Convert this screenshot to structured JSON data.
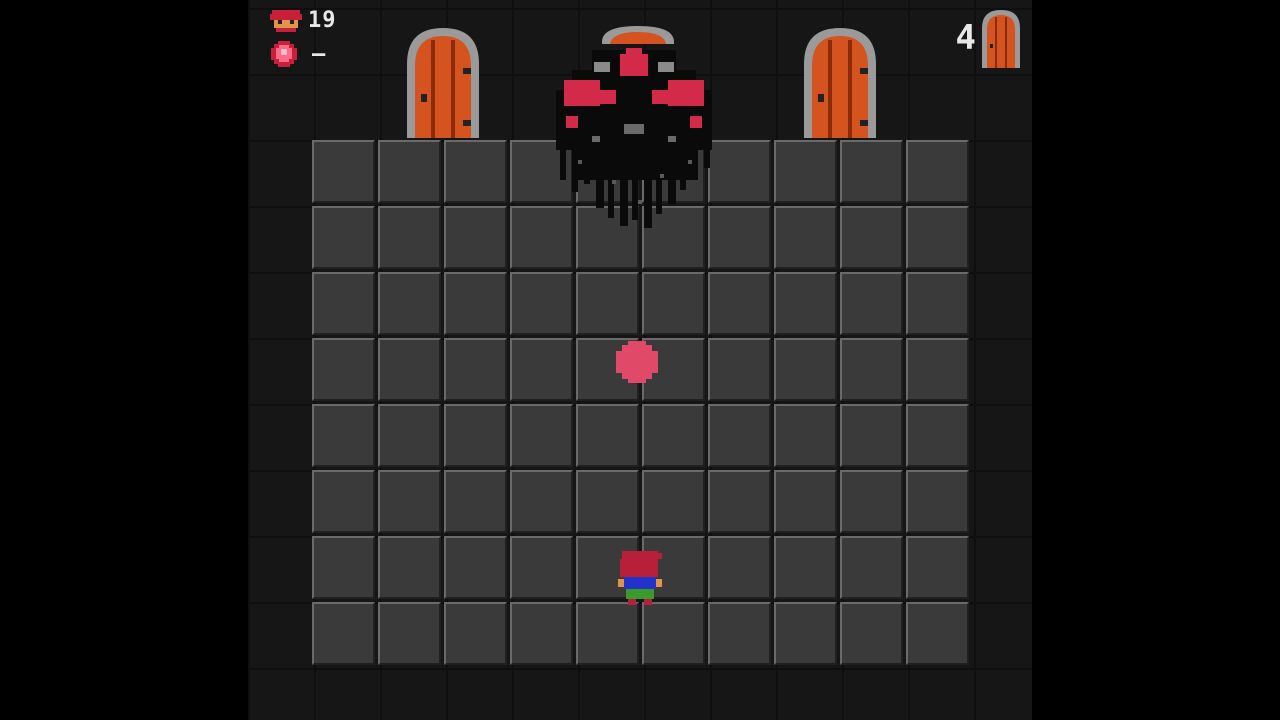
{
  "hud": {
    "lives_count": "19",
    "lives_icon": "player-head-icon",
    "orb_icon": "pink-orb-icon",
    "orb_count": "–",
    "doors_remaining": "4",
    "doors_icon": "door-icon"
  },
  "scene": {
    "floor_columns": 10,
    "floor_rows": 8,
    "doors": 3,
    "boss": "shadow-tentacle-boss",
    "projectile": "pink-energy-orb",
    "player": "red-haired-hero"
  },
  "colors": {
    "door_wood": "#d4531e",
    "door_frame": "#b8b8b8",
    "boss_accent": "#d42a4a",
    "projectile": "#e04a68",
    "player_hair": "#b8203a",
    "player_shirt": "#2233cc",
    "player_pants": "#3a9a2a"
  }
}
